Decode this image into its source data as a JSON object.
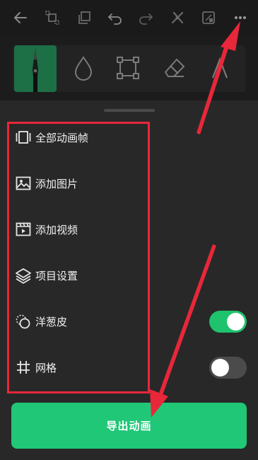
{
  "top_bar": {
    "icons": [
      "back-arrow-icon",
      "transform-icon",
      "layers-icon",
      "undo-icon",
      "redo-icon",
      "magic-icon",
      "crop-icon",
      "more-icon"
    ]
  },
  "tools": {
    "items": [
      "pen-tool",
      "fill-tool",
      "select-tool",
      "eraser-tool",
      "text-tool"
    ],
    "active": "pen-tool"
  },
  "menu": {
    "items": [
      {
        "icon": "all-frames-icon",
        "label": "全部动画帧"
      },
      {
        "icon": "image-icon",
        "label": "添加图片"
      },
      {
        "icon": "video-icon",
        "label": "添加视频"
      },
      {
        "icon": "layers-icon",
        "label": "项目设置"
      },
      {
        "icon": "onion-skin-icon",
        "label": "洋葱皮",
        "toggle": true
      },
      {
        "icon": "grid-icon",
        "label": "网格",
        "toggle": false
      }
    ]
  },
  "export": {
    "label": "导出动画"
  },
  "colors": {
    "accent": "#1fc777",
    "toggle_on": "#1fc36d",
    "highlight": "#e8273a",
    "sheet": "#282828"
  }
}
